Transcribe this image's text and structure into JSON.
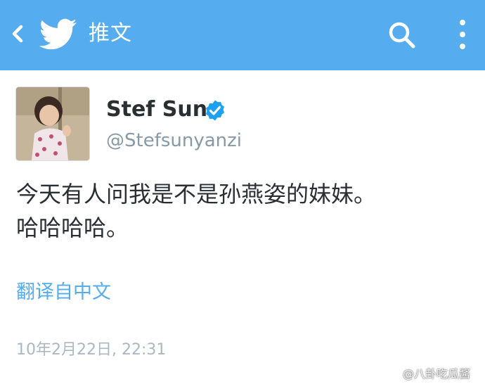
{
  "topbar": {
    "title": "推文",
    "background": "#55acee",
    "back_icon": "chevron-left-icon",
    "logo_icon": "twitter-bird-icon",
    "search_icon": "search-icon",
    "menu_icon": "more-vertical-icon"
  },
  "tweet": {
    "display_name": "Stef Sun",
    "verified": true,
    "handle": "@Stefsunyanzi",
    "text_lines": [
      "今天有人问我是不是孙燕姿的妹妹。",
      "哈哈哈哈。"
    ],
    "translate_label": "翻译自中文",
    "timestamp": "10年2月22日, 22:31"
  },
  "watermark": {
    "text": "@八卦吃瓜酱"
  },
  "colors": {
    "accent": "#55acee",
    "name_text": "#292f33",
    "secondary_text": "#8899a6",
    "timestamp_text": "#aab8c2"
  }
}
